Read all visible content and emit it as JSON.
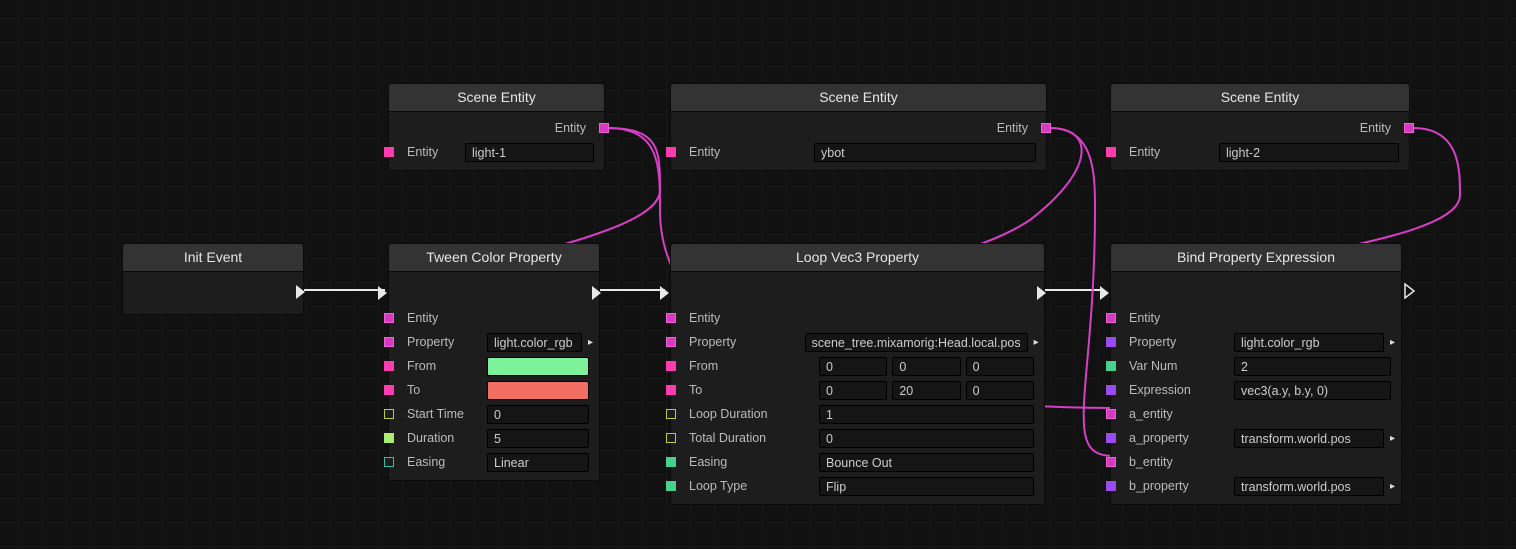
{
  "colors": {
    "magenta": "#d63abf",
    "flow": "#e8e8e8",
    "olive": "#b8cc40",
    "teal": "#2fbfa0",
    "green": "#46d28c",
    "purple": "#9a4af0",
    "hot": "#ff3bb0",
    "lime": "#a9ec70"
  },
  "init": {
    "title": "Init Event"
  },
  "scene1": {
    "title": "Scene Entity",
    "outLabel": "Entity",
    "inLabel": "Entity",
    "value": "light-1"
  },
  "scene2": {
    "title": "Scene Entity",
    "outLabel": "Entity",
    "inLabel": "Entity",
    "value": "ybot"
  },
  "scene3": {
    "title": "Scene Entity",
    "outLabel": "Entity",
    "inLabel": "Entity",
    "value": "light-2"
  },
  "tween": {
    "title": "Tween Color Property",
    "entity": "Entity",
    "property_lbl": "Property",
    "property_val": "light.color_rgb",
    "from_lbl": "From",
    "to_lbl": "To",
    "start_lbl": "Start Time",
    "start_val": "0",
    "dur_lbl": "Duration",
    "dur_val": "5",
    "easing_lbl": "Easing",
    "easing_val": "Linear"
  },
  "loop": {
    "title": "Loop Vec3 Property",
    "entity": "Entity",
    "property_lbl": "Property",
    "property_val": "scene_tree.mixamorig:Head.local.pos",
    "from_lbl": "From",
    "from": {
      "x": "0",
      "y": "0",
      "z": "0"
    },
    "to_lbl": "To",
    "to": {
      "x": "0",
      "y": "20",
      "z": "0"
    },
    "loopdur_lbl": "Loop Duration",
    "loopdur_val": "1",
    "totaldur_lbl": "Total Duration",
    "totaldur_val": "0",
    "easing_lbl": "Easing",
    "easing_val": "Bounce Out",
    "looptype_lbl": "Loop Type",
    "looptype_val": "Flip"
  },
  "bind": {
    "title": "Bind Property Expression",
    "entity": "Entity",
    "property_lbl": "Property",
    "property_val": "light.color_rgb",
    "varnum_lbl": "Var Num",
    "varnum_val": "2",
    "expr_lbl": "Expression",
    "expr_val": "vec3(a.y, b.y, 0)",
    "aentity_lbl": "a_entity",
    "aprop_lbl": "a_property",
    "aprop_val": "transform.world.pos",
    "bentity_lbl": "b_entity",
    "bprop_lbl": "b_property",
    "bprop_val": "transform.world.pos"
  }
}
